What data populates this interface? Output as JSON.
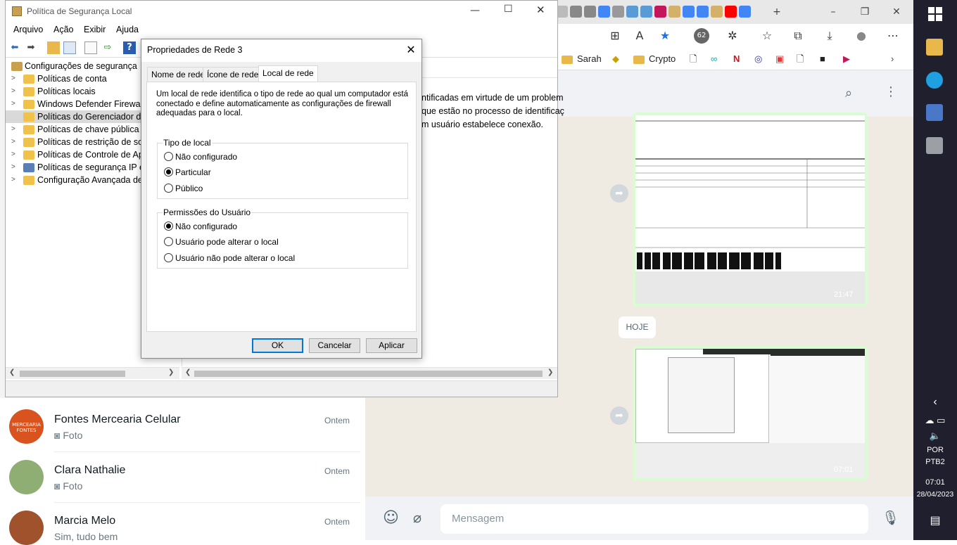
{
  "mmc": {
    "title": "Política de Segurança Local",
    "menu": [
      "Arquivo",
      "Ação",
      "Exibir",
      "Ajuda"
    ],
    "tree": [
      {
        "label": "Configurações de segurança",
        "chevron": ""
      },
      {
        "label": "Políticas de conta",
        "chevron": ">"
      },
      {
        "label": "Políticas locais",
        "chevron": ">"
      },
      {
        "label": "Windows Defender Firewall c",
        "chevron": ">"
      },
      {
        "label": "Políticas do Gerenciador de",
        "chevron": ""
      },
      {
        "label": "Políticas de chave pública",
        "chevron": ">"
      },
      {
        "label": "Políticas de restrição de soft",
        "chevron": ">"
      },
      {
        "label": "Políticas de Controle de Apli",
        "chevron": ">"
      },
      {
        "label": "Políticas de segurança IP em",
        "chevron": ">"
      },
      {
        "label": "Configuração Avançada de P",
        "chevron": ">"
      }
    ],
    "content_lines": [
      "ntificadas em virtude de um problem",
      "que estão no processo de identificaç",
      "m usuário estabelece conexão."
    ]
  },
  "dialog": {
    "title": "Propriedades de Rede 3",
    "tabs": [
      "Nome de rede",
      "Ícone de rede",
      "Local de rede"
    ],
    "description": "Um local de rede identifica o tipo de rede ao qual um computador está conectado e define automaticamente as configurações de firewall adequadas para o local.",
    "location_group": {
      "title": "Tipo de local",
      "options": [
        {
          "label": "Não configurado",
          "selected": false
        },
        {
          "label": "Particular",
          "selected": true
        },
        {
          "label": "Público",
          "selected": false
        }
      ]
    },
    "permissions_group": {
      "title": "Permissões do Usuário",
      "options": [
        {
          "label": "Não configurado",
          "selected": true
        },
        {
          "label": "Usuário pode alterar o local",
          "selected": false
        },
        {
          "label": "Usuário não pode alterar o local",
          "selected": false
        }
      ]
    },
    "buttons": {
      "ok": "OK",
      "cancel": "Cancelar",
      "apply": "Aplicar"
    }
  },
  "browser": {
    "favorites": [
      "Sarah",
      "Crypto"
    ],
    "badge": "62"
  },
  "whatsapp": {
    "date_chip": "HOJE",
    "msg1_time": "21:47",
    "msg2_time": "07:01",
    "message_placeholder": "Mensagem",
    "chats": [
      {
        "name": "Fontes Mercearia Celular",
        "sub": "Foto",
        "time": "Ontem",
        "avatar_color": "#d9531e",
        "avatar_text": "MERCEARIA FONTES"
      },
      {
        "name": "Clara Nathalie",
        "sub": "Foto",
        "time": "Ontem",
        "avatar_color": "#8fae73",
        "avatar_text": ""
      },
      {
        "name": "Marcia Melo",
        "sub": "Sim, tudo bem",
        "time": "Ontem",
        "avatar_color": "#a0522d",
        "avatar_text": ""
      }
    ]
  },
  "taskbar": {
    "lang1": "POR",
    "lang2": "PTB2",
    "time": "07:01",
    "date": "28/04/2023"
  }
}
